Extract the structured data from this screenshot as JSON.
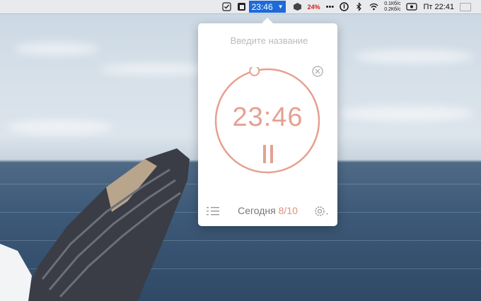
{
  "menubar": {
    "timer": "23:46",
    "battery": "24%",
    "net_up": "0.1Кб/с",
    "net_down": "0.2Кб/с",
    "clock": "Пт 22:41",
    "icons": [
      "checkmark-icon",
      "clipboard-icon",
      "timer-dropdown-icon",
      "cube-icon",
      "more-icon",
      "info-icon",
      "bluetooth-icon",
      "wifi-icon",
      "screen-icon",
      "flag-icon"
    ]
  },
  "popover": {
    "title_placeholder": "Введите название",
    "timer": "23:46",
    "progress": 0.96,
    "today_label": "Сегодня",
    "today_count": "8/10"
  },
  "colors": {
    "accent": "#e6a090",
    "accent_dark": "#e09080",
    "menubar_highlight": "#1e6ad8"
  }
}
